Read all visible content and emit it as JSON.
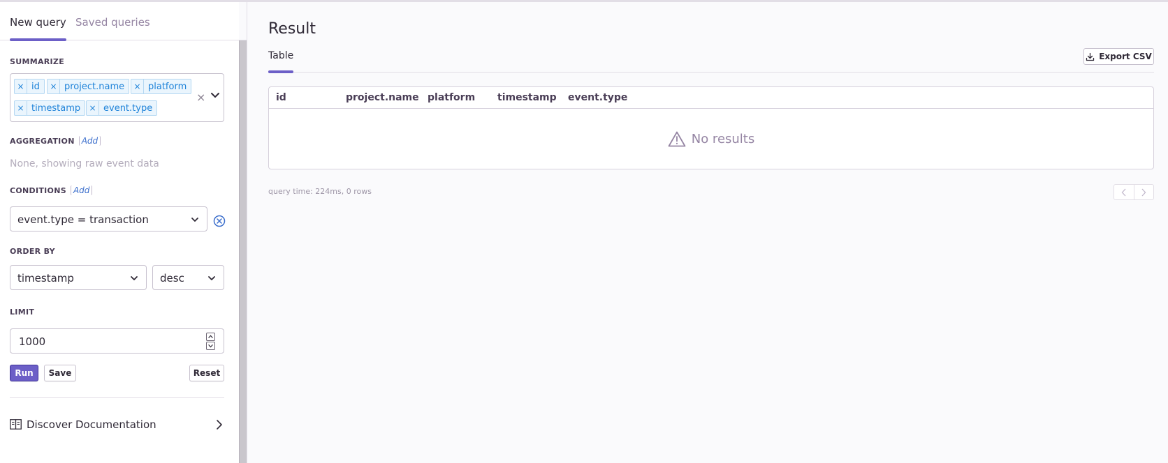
{
  "sidebar": {
    "tabs": [
      {
        "label": "New query",
        "active": true
      },
      {
        "label": "Saved queries",
        "active": false
      }
    ],
    "summarize": {
      "label": "Summarize",
      "fields": [
        "id",
        "project.name",
        "platform",
        "timestamp",
        "event.type"
      ],
      "clear_icon": "close-icon",
      "dropdown_icon": "chevron-down-icon"
    },
    "aggregation": {
      "label": "Aggregation",
      "add_label": "Add",
      "empty_text": "None, showing raw event data"
    },
    "conditions": {
      "label": "Conditions",
      "add_label": "Add",
      "items": [
        {
          "value": "event.type = transaction"
        }
      ]
    },
    "order_by": {
      "label": "Order by",
      "field": "timestamp",
      "direction": "desc"
    },
    "limit": {
      "label": "Limit",
      "value": "1000"
    },
    "buttons": {
      "run": "Run",
      "save": "Save",
      "reset": "Reset"
    },
    "doc_link": "Discover Documentation"
  },
  "main": {
    "title": "Result",
    "tab": "Table",
    "export_label": "Export CSV",
    "columns": [
      "id",
      "project.name",
      "platform",
      "timestamp",
      "event.type"
    ],
    "empty_text": "No results",
    "query_time": "query time: 224ms, 0 rows"
  },
  "colors": {
    "accent": "#6c5fc7",
    "chip_text": "#1f83d9",
    "chip_bg": "#eaf5fd",
    "link": "#3b6ecc"
  }
}
